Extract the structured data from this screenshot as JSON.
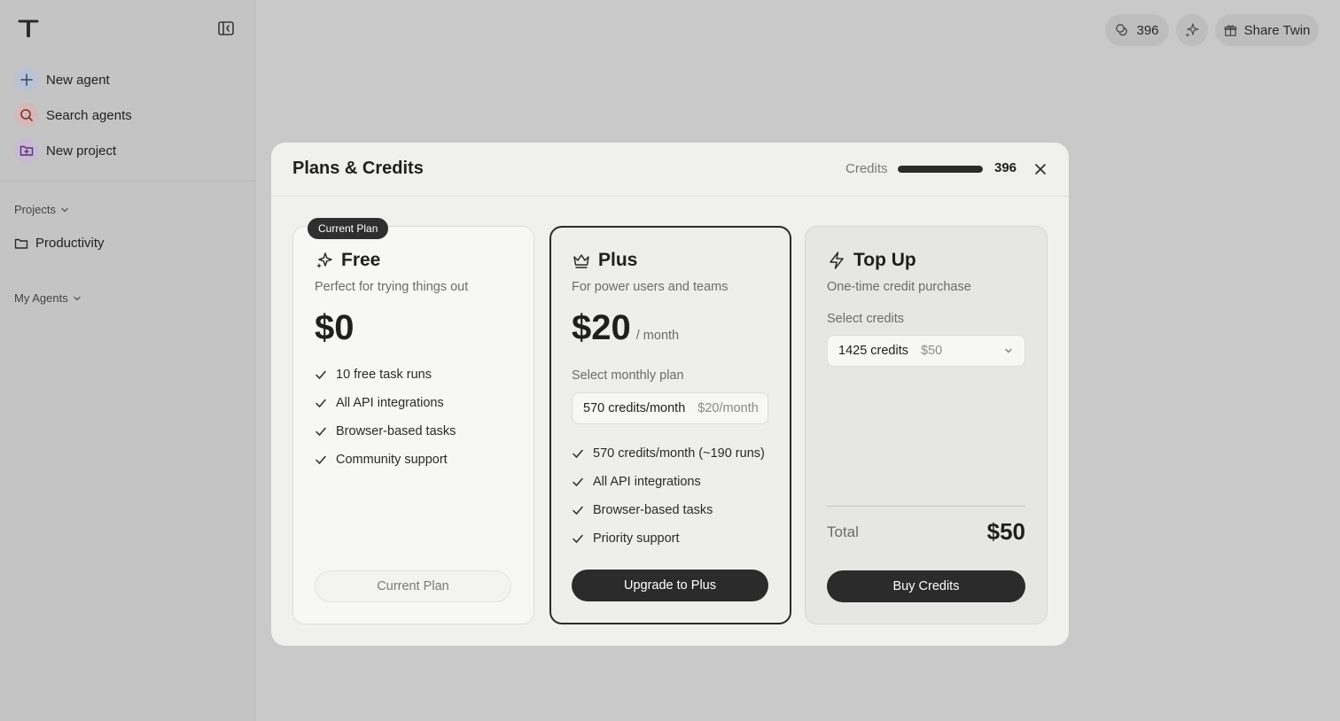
{
  "sidebar": {
    "actions": [
      {
        "label": "New agent",
        "icon": "plus-icon",
        "color": "#b9c3d4"
      },
      {
        "label": "Search agents",
        "icon": "search-icon",
        "color": "#d4b9b9"
      },
      {
        "label": "New project",
        "icon": "folder-plus-icon",
        "color": "#c7bad2"
      }
    ],
    "projects_label": "Projects",
    "project_items": [
      "Productivity"
    ],
    "my_agents_label": "My Agents"
  },
  "topbar": {
    "credits": "396",
    "share_label": "Share Twin"
  },
  "modal": {
    "title": "Plans & Credits",
    "credits_label": "Credits",
    "credits_value": "396",
    "credits_fill": 1.0,
    "plans": {
      "free": {
        "badge": "Current Plan",
        "name": "Free",
        "description": "Perfect for trying things out",
        "price": "$0",
        "features": [
          "10 free task runs",
          "All API integrations",
          "Browser-based tasks",
          "Community support"
        ],
        "button": "Current Plan"
      },
      "plus": {
        "name": "Plus",
        "description": "For power users and teams",
        "price": "$20",
        "period": "/ month",
        "select_label": "Select monthly plan",
        "select_value": "570 credits/month",
        "select_price": "$20/month",
        "features": [
          "570 credits/month (~190 runs)",
          "All API integrations",
          "Browser-based tasks",
          "Priority support"
        ],
        "button": "Upgrade to Plus"
      },
      "topup": {
        "name": "Top Up",
        "description": "One-time credit purchase",
        "select_label": "Select credits",
        "select_value": "1425 credits",
        "select_price": "$50",
        "total_label": "Total",
        "total_value": "$50",
        "button": "Buy Credits"
      }
    }
  }
}
